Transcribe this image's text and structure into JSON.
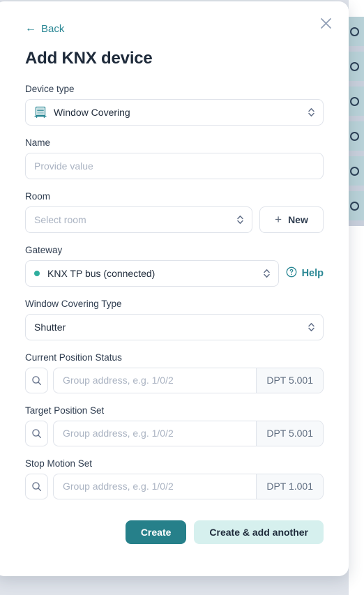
{
  "background": {
    "row_chip_icon": "circle-outline-icon",
    "row_count": 6,
    "row_color": "#b9d2d8",
    "page_bg": "#dfe3ea"
  },
  "dialog": {
    "back_label": "Back",
    "back_icon": "arrow-left-icon",
    "close_icon": "close-icon",
    "title": "Add KNX device",
    "accent_color": "#2a8794"
  },
  "form": {
    "device_type": {
      "label": "Device type",
      "value": "Window Covering",
      "icon": "window-covering-icon",
      "chevron_icon": "chevron-up-down-icon"
    },
    "name": {
      "label": "Name",
      "value": "",
      "placeholder": "Provide value"
    },
    "room": {
      "label": "Room",
      "value": "",
      "placeholder": "Select room",
      "chevron_icon": "chevron-up-down-icon",
      "new_button": {
        "label": "New",
        "icon": "plus-icon"
      }
    },
    "gateway": {
      "label": "Gateway",
      "value": "KNX TP bus (connected)",
      "status_dot_color": "#2fae9e",
      "chevron_icon": "chevron-up-down-icon",
      "help": {
        "label": "Help",
        "icon": "question-circle-icon"
      }
    },
    "window_covering_type": {
      "label": "Window Covering Type",
      "value": "Shutter",
      "chevron_icon": "chevron-up-down-icon"
    },
    "group_addresses": [
      {
        "label": "Current Position Status",
        "value": "",
        "placeholder": "Group address, e.g. 1/0/2",
        "dpt": "DPT 5.001",
        "search_icon": "search-icon"
      },
      {
        "label": "Target Position Set",
        "value": "",
        "placeholder": "Group address, e.g. 1/0/2",
        "dpt": "DPT 5.001",
        "search_icon": "search-icon"
      },
      {
        "label": "Stop Motion Set",
        "value": "",
        "placeholder": "Group address, e.g. 1/0/2",
        "dpt": "DPT 1.001",
        "search_icon": "search-icon"
      }
    ]
  },
  "footer": {
    "create_label": "Create",
    "create_add_another_label": "Create & add another",
    "primary_color": "#26808a",
    "soft_color": "#d6f0ee"
  }
}
